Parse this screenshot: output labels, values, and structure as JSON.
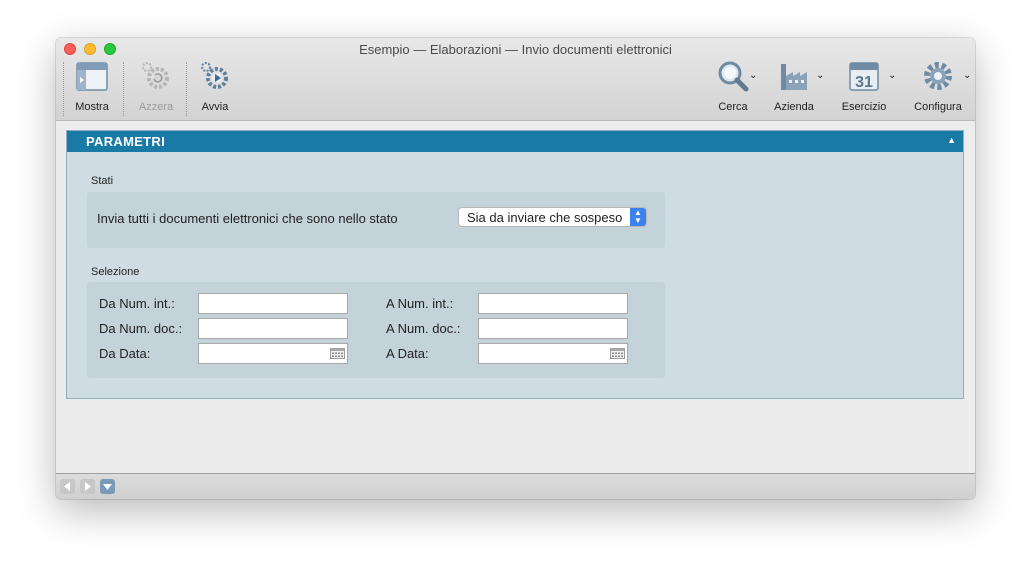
{
  "window": {
    "title": "Esempio — Elaborazioni — Invio documenti elettronici"
  },
  "toolbar": {
    "mostra": "Mostra",
    "azzera": "Azzera",
    "avvia": "Avvia",
    "cerca": "Cerca",
    "azienda": "Azienda",
    "esercizio": "Esercizio",
    "esercizio_day": "31",
    "configura": "Configura"
  },
  "panel": {
    "title": "PARAMETRI",
    "stati": {
      "label": "Stati",
      "text": "Invia tutti i documenti elettronici che sono nello stato",
      "selected": "Sia da inviare che sospeso"
    },
    "selezione": {
      "label": "Selezione",
      "da_num_int": "Da Num. int.:",
      "a_num_int": "A Num. int.:",
      "da_num_doc": "Da Num. doc.:",
      "a_num_doc": "A Num. doc.:",
      "da_data": "Da Data:",
      "a_data": "A Data:",
      "values": {
        "da_num_int": "",
        "a_num_int": "",
        "da_num_doc": "",
        "a_num_doc": "",
        "da_data": "",
        "a_data": ""
      }
    }
  },
  "colors": {
    "panel_header": "#1a7aa6",
    "panel_bg": "#cfdce3",
    "accent": "#3b82f0"
  },
  "icons": [
    "mostra-icon",
    "azzera-icon",
    "avvia-icon",
    "cerca-icon",
    "azienda-icon",
    "esercizio-icon",
    "configura-icon",
    "calendar-icon",
    "nav-back-icon",
    "nav-forward-icon",
    "nav-down-icon"
  ]
}
